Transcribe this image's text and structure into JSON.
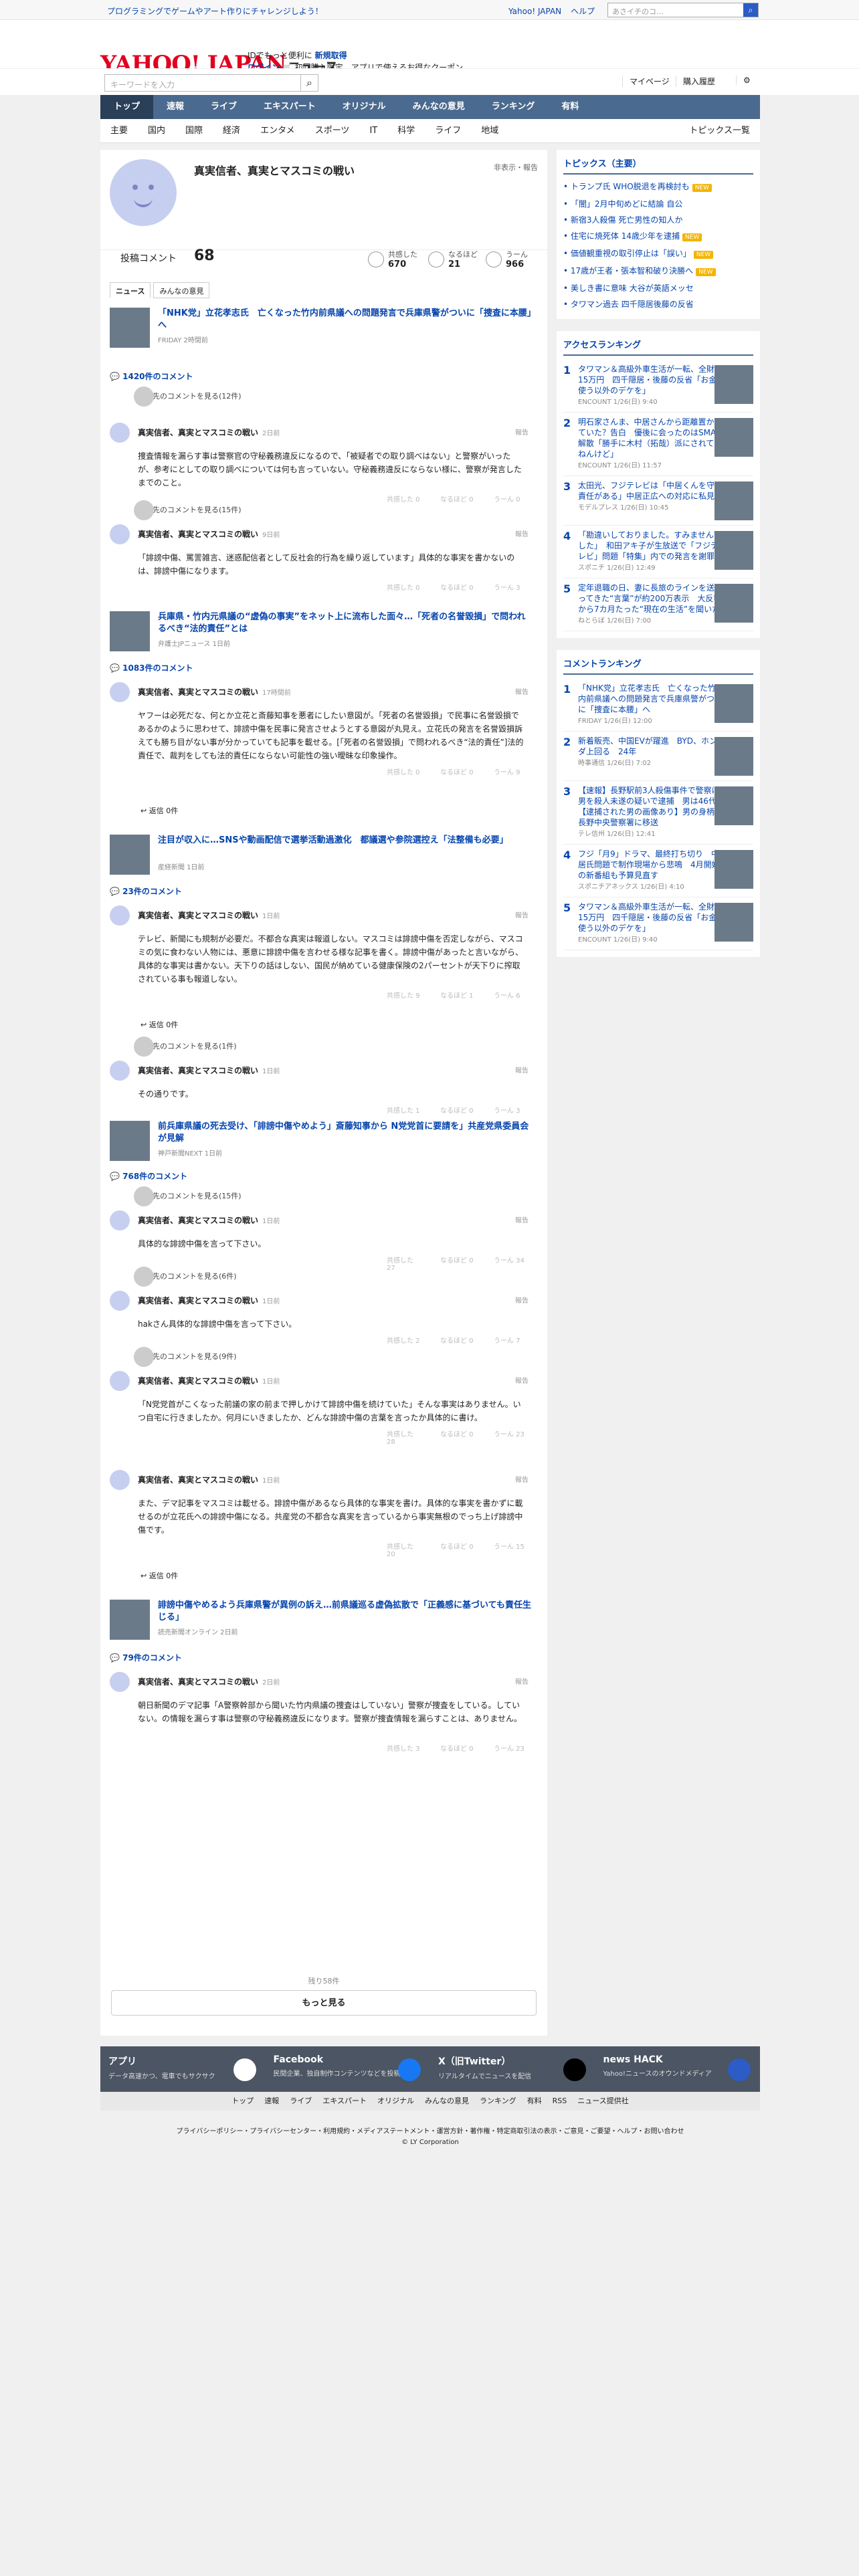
{
  "topbar": {
    "promo": "プログラミングでゲームやアート作りにチャレンジしよう！",
    "links": [
      "Yahoo! JAPAN",
      "ヘルプ"
    ],
    "search_placeholder": "ウェブ検索",
    "search_value": "あさイチのコ..."
  },
  "header": {
    "logo": "YAHOO! JAPAN",
    "logo_sub": "ニュース",
    "line1": "IDでもっと便利に",
    "line1b": "新規取得",
    "line2a": "ログイン",
    "line2b": "初回購入限定、アプリで使えるお得なクーポン"
  },
  "searchrow": {
    "placeholder": "キーワードを入力",
    "mypage": "マイページ",
    "history": "購入履歴"
  },
  "nav": [
    "トップ",
    "速報",
    "ライブ",
    "エキスパート",
    "オリジナル",
    "みんなの意見",
    "ランキング",
    "有料"
  ],
  "subnav": [
    "主要",
    "国内",
    "国際",
    "経済",
    "エンタメ",
    "スポーツ",
    "IT",
    "科学",
    "ライフ",
    "地域"
  ],
  "subnav_right": "トピックス一覧",
  "profile": {
    "name": "真実信者、真実とマスコミの戦い",
    "flag": "非表示・報告",
    "count_label": "投稿コメント",
    "count": "68",
    "reactions": [
      {
        "label": "共感した",
        "value": "670"
      },
      {
        "label": "なるほど",
        "value": "21"
      },
      {
        "label": "うーん",
        "value": "966"
      }
    ],
    "tabs": [
      "ニュース",
      "みんなの意見"
    ]
  },
  "articles": [
    {
      "title": "「NHK党」立花孝志氏　亡くなった竹内前県議への問題発言で兵庫県警がついに「捜査に本腰」へ",
      "src": "FRIDAY 2時間前",
      "count": "1420件のコメント"
    },
    {
      "title": "兵庫県・竹内元県議の“虚偽の事実”をネット上に流布した面々…「死者の名誉毀損」で問われるべき“法的責任”とは",
      "src": "弁護士JPニュース 1日前",
      "count": "1083件のコメント"
    },
    {
      "title": "注目が収入に…SNSや動画配信で選挙活動過激化　都議選や参院選控え「法整備も必要」",
      "src": "産経新聞 1日前",
      "count": "23件のコメント"
    },
    {
      "title": "前兵庫県議の死去受け、「誹謗中傷やめよう」斎藤知事から N党党首に要請を」共産党県委員会が見解",
      "src": "神戸新聞NEXT 1日前",
      "count": "768件のコメント"
    },
    {
      "title": "誹謗中傷やめるよう兵庫県警が異例の訴え…前県議巡る虚偽拡散で「正義感に基づいても責任生じる」",
      "src": "読売新聞オンライン 2日前",
      "count": "79件のコメント"
    }
  ],
  "replies_more": [
    "返信先のコメントを見る(12件)",
    "返信先のコメントを見る(15件)",
    "返信先のコメントを見る(1件)",
    "返信先のコメントを見る(15件)",
    "返信先のコメントを見る(6件)",
    "返信先のコメントを見る(9件)"
  ],
  "comments": [
    {
      "time": "2日前",
      "text": "捜査情報を漏らす事は警察官の守秘義務違反になるので、「被疑者での取り調べはない」と警察がいったが、参考にとしての取り調べについては何も言っていない。守秘義務違反にならない様に、警察が発言したまでのこと。",
      "votes": [
        "0",
        "0",
        "0"
      ]
    },
    {
      "time": "9日前",
      "text": "「誹謗中傷、罵詈雑言、迷惑配信者として反社会的行為を繰り返しています」具体的な事実を書かないのは、誹謗中傷になります。",
      "votes": [
        "0",
        "0",
        "3"
      ]
    },
    {
      "time": "17時間前",
      "text": "ヤフーは必死だな、何とか立花と斎藤知事を悪者にしたい意図が。「死者の名誉毀損」で民事に名誉毀損であるかのように思わせて、誹謗中傷を民事に発言させようとする意図が丸見え。立花氏の発言を名誉毀損訴えても勝ち目がない事が分かっていても記事を載せる。[「死者の名誉毀損」で問われるべき“法的責任”]法的責任で、裁判をしても法的責任にならない可能性の強い曖昧な印象操作。",
      "votes": [
        "0",
        "0",
        "9"
      ]
    },
    {
      "time": "1日前",
      "text": "テレビ、新聞にも規制が必要だ。不都合な真実は報道しない。マスコミは誹謗中傷を否定しながら、マスコミの気に食わない人物には、悪意に誹謗中傷を言わせる様な記事を書く。誹謗中傷があったと言いながら、具体的な事実は書かない。天下りの話はしない、国民が納めている健康保険の2パーセントが天下りに搾取されている事も報道しない。",
      "votes": [
        "9",
        "1",
        "6"
      ]
    },
    {
      "time": "1日前",
      "text": "その通りです。",
      "votes": [
        "1",
        "0",
        "3"
      ]
    },
    {
      "time": "1日前",
      "text": "具体的な誹謗中傷を言って下さい。",
      "votes": [
        "27",
        "0",
        "34"
      ]
    },
    {
      "time": "1日前",
      "text": "hakさん具体的な誹謗中傷を言って下さい。",
      "votes": [
        "2",
        "0",
        "7"
      ]
    },
    {
      "time": "1日前",
      "text": "「N党党首がこくなった前議の家の前まで押しかけて誹謗中傷を続けていた」そんな事実はありません。いつ自宅に行きましたか。何月にいきましたか、どんな誹謗中傷の言葉を言ったか具体的に書け。",
      "votes": [
        "28",
        "0",
        "23"
      ]
    },
    {
      "time": "1日前",
      "text": "また、デマ記事をマスコミは載せる。誹謗中傷があるなら具体的な事実を書け。具体的な事実を書かずに載せるのが立花氏への誹謗中傷になる。共産党の不都合な真実を言っているから事実無根のでっち上げ誹謗中傷です。",
      "votes": [
        "20",
        "0",
        "15"
      ]
    },
    {
      "time": "2日前",
      "text": "朝日新聞のデマ記事「A警察幹部から聞いた竹内県議の捜査はしていない」警察が捜査をしている。していない。の情報を漏らす事は警察の守秘義務違反になります。警察が捜査情報を漏らすことは、ありません。",
      "votes": [
        "3",
        "0",
        "23"
      ]
    }
  ],
  "reply_label": "返信 0件",
  "report_label": "報告",
  "vote_labels": [
    "共感した",
    "なるほど",
    "うーん"
  ],
  "author_name": "真実信者、真実とマスコミの戦い",
  "remaining": "残り58件",
  "more_label": "もっと見る",
  "topics": {
    "title": "トピックス（主要）",
    "items": [
      {
        "t": "トランプ氏 WHO脱退を再検討も",
        "new": true
      },
      {
        "t": "「闇」2月中旬めどに結論 自公",
        "new": false
      },
      {
        "t": "新宿3人殺傷 死亡男性の知人か",
        "new": false
      },
      {
        "t": "住宅に焼死体 14歳少年を逮捕",
        "new": true
      },
      {
        "t": "価値観重視の取引停止は「誤い」",
        "new": true
      },
      {
        "t": "17歳が王者・張本智和破り決勝へ",
        "new": true
      },
      {
        "t": "美しき書に意味 大谷が英語メッセ",
        "new": false
      },
      {
        "t": "タワマン過去 四千隠居後藤の反省",
        "new": false
      }
    ]
  },
  "access": {
    "title": "アクセスランキング",
    "items": [
      {
        "t": "タワマン＆高級外車生活が一転、全財産15万円　四千隠居・後藤の反省「お金使う以外のデケを」",
        "m": "ENCOUNT 1/26(日) 9:40"
      },
      {
        "t": "明石家さんま、中居さんから距離置かれていた？告白　優後に会ったのはSMAP解散「勝手に木村（拓哉）派にされてんねんけど」",
        "m": "ENCOUNT 1/26(日) 11:57"
      },
      {
        "t": "太田光、フジテレビは「中居くんを守る責任がある」中居正広への対応に私見",
        "m": "モデルプレス 1/26(日) 10:45"
      },
      {
        "t": "「勘違いしておりました。すみませんでした」　和田アキ子が生放送で「フジテレビ」問題「特集」内での発言を謝罪",
        "m": "スポニチ 1/26(日) 12:49"
      },
      {
        "t": "定年退職の日、妻に長旅のラインを送ってきた“言葉”が約200万表示　大反響から7カ月たった“現在の生活”を聞いた",
        "m": "ねとらぼ 1/26(日) 7:00"
      }
    ]
  },
  "comment_rank": {
    "title": "コメントランキング",
    "items": [
      {
        "t": "「NHK党」立花孝志氏　亡くなった竹内前県議への問題発言で兵庫県警がついに「捜査に本腰」へ",
        "m": "FRIDAY 1/26(日) 12:00"
      },
      {
        "t": "新着販売、中国EVが躍進　BYD、ホンダ上回る　24年",
        "m": "時事通信 1/26(日) 7:02"
      },
      {
        "t": "【速報】長野駅前3人殺傷事件で警察は男を殺人未遂の疑いで逮捕　男は46代　【逮捕された男の画像あり】男の身柄は長野中央警察署に移送",
        "m": "テレ信州 1/26(日) 12:41"
      },
      {
        "t": "フジ「月9」ドラマ、最終打ち切り　中居氏問題で制作現場から悲鳴　4月開始の新番組も予算見直す",
        "m": "スポニチアネックス 1/26(日) 4:10"
      },
      {
        "t": "タワマン＆高級外車生活が一転、全財産15万円　四千隠居・後藤の反省「お金使う以外のデケを」",
        "m": "ENCOUNT 1/26(日) 9:40"
      }
    ]
  },
  "footer": [
    {
      "h": "アプリ",
      "s": "データ高速かつ、電車でもサクサク"
    },
    {
      "h": "Facebook",
      "s": "民間企業、独自制作コンテンツなどを投稿"
    },
    {
      "h": "X（旧Twitter）",
      "s": "リアルタイムでニュースを配信"
    },
    {
      "h": "news HACK",
      "s": "Yahoo!ニュースのオウンドメディア"
    }
  ],
  "fnav": [
    "トップ",
    "速報",
    "ライブ",
    "エキスパート",
    "オリジナル",
    "みんなの意見",
    "ランキング",
    "有料",
    "RSS",
    "ニュース提供社"
  ],
  "flinks": "プライバシーポリシー・プライバシーセンター・利用規約・メディアステートメント・運営方針・著作権・特定商取引法の表示・ご意見・ご要望・ヘルプ・お問い合わせ",
  "copyright": "© LY Corporation"
}
